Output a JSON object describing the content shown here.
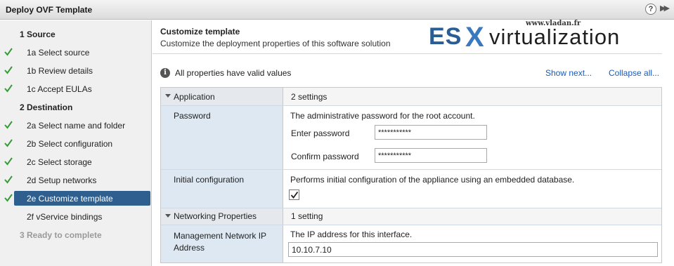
{
  "window": {
    "title": "Deploy OVF Template",
    "help_glyph": "?",
    "expand_glyph": "▶▶"
  },
  "steps": [
    {
      "label": "1  Source",
      "type": "section",
      "done": false
    },
    {
      "label": "1a  Select source",
      "type": "step",
      "done": true
    },
    {
      "label": "1b  Review details",
      "type": "step",
      "done": true
    },
    {
      "label": "1c  Accept EULAs",
      "type": "step",
      "done": true
    },
    {
      "label": "2  Destination",
      "type": "section",
      "done": false
    },
    {
      "label": "2a  Select name and folder",
      "type": "step",
      "done": true
    },
    {
      "label": "2b  Select configuration",
      "type": "step",
      "done": true
    },
    {
      "label": "2c  Select storage",
      "type": "step",
      "done": true
    },
    {
      "label": "2d  Setup networks",
      "type": "step",
      "done": true
    },
    {
      "label": "2e  Customize template",
      "type": "step",
      "done": true,
      "active": true
    },
    {
      "label": "2f  vService bindings",
      "type": "step",
      "done": false
    },
    {
      "label": "3  Ready to complete",
      "type": "section-disabled",
      "done": false
    }
  ],
  "main": {
    "heading": "Customize template",
    "subheading": "Customize the deployment properties of this software solution",
    "status_text": "All properties have valid values",
    "show_next": "Show next...",
    "collapse_all": "Collapse all..."
  },
  "watermark": {
    "url": "www.vladan.fr",
    "part1": "ES",
    "part2": "X",
    "part3": "virtualization"
  },
  "properties": {
    "application": {
      "label": "Application",
      "count": "2 settings"
    },
    "password": {
      "label": "Password",
      "description": "The administrative password for the root account.",
      "enter_label": "Enter password",
      "enter_value": "***********",
      "confirm_label": "Confirm password",
      "confirm_value": "***********"
    },
    "initial_config": {
      "label": "Initial configuration",
      "description": "Performs initial configuration of the appliance using an embedded database.",
      "checked": true
    },
    "networking": {
      "label": "Networking Properties",
      "count": "1 setting"
    },
    "mgmt_ip": {
      "label_line1": "Management Network IP",
      "label_line2": "Address",
      "description": "The IP address for this interface.",
      "value": "10.10.7.10"
    }
  },
  "colors": {
    "accent": "#2f5f8f",
    "link": "#1a5ab8",
    "check": "#3a9a3a",
    "property_label_bg": "#dde8f3"
  }
}
